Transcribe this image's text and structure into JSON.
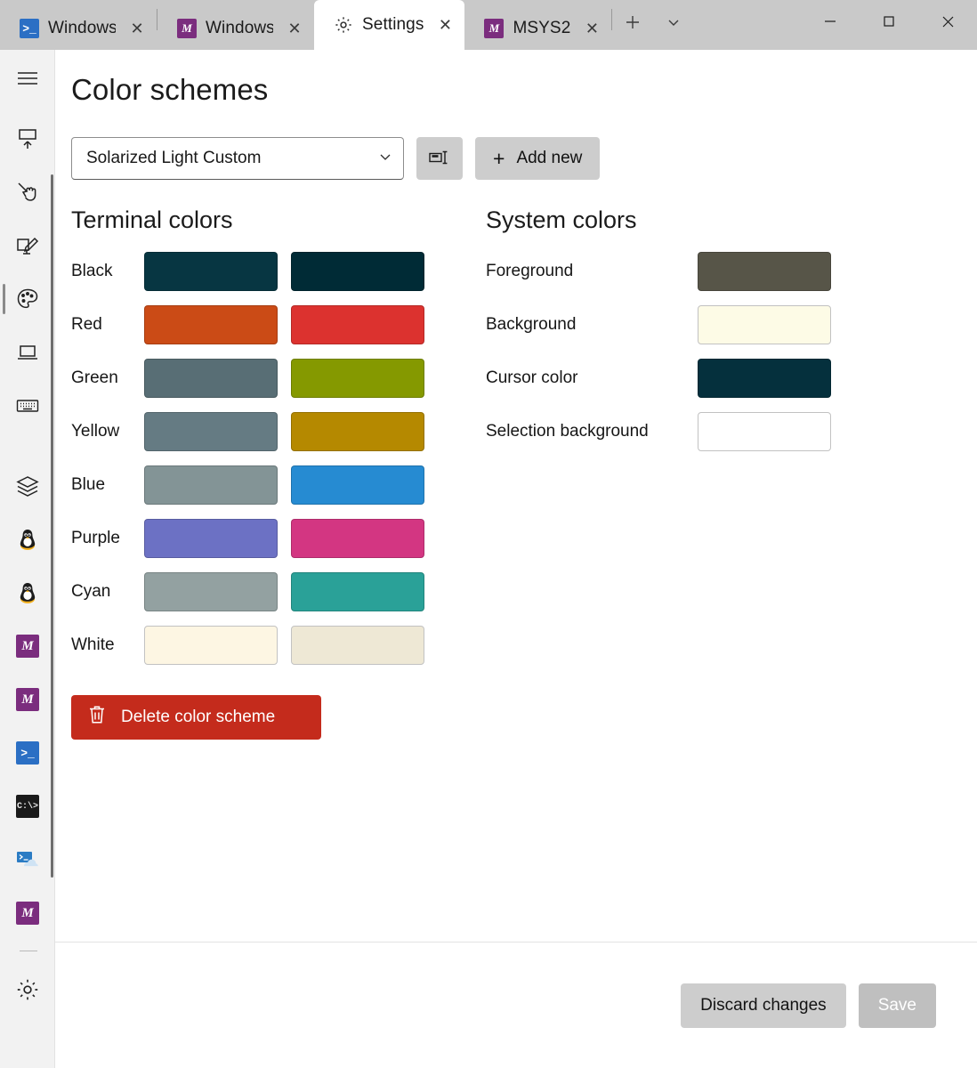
{
  "window": {
    "tabs": [
      {
        "icon": "powershell-icon",
        "label": "Windows PowerShell",
        "active": false
      },
      {
        "icon": "msys2-icon",
        "label": "Windows",
        "active": false
      },
      {
        "icon": "settings-gear-icon",
        "label": "Settings",
        "active": true
      },
      {
        "icon": "msys2-icon",
        "label": "MSYS2",
        "active": false
      }
    ],
    "close_label": "✕",
    "new_tab_label": "+",
    "dropdown_label": "⌄",
    "minimize_label": "─",
    "maximize_label": "□",
    "close_window_label": "✕"
  },
  "rail": {
    "items": [
      {
        "name": "hamburger-menu",
        "kind": "glyph"
      },
      {
        "name": "startup",
        "kind": "glyph"
      },
      {
        "name": "interaction",
        "kind": "glyph"
      },
      {
        "name": "appearance",
        "kind": "glyph"
      },
      {
        "name": "color-schemes",
        "kind": "glyph",
        "selected": true
      },
      {
        "name": "rendering",
        "kind": "glyph"
      },
      {
        "name": "actions",
        "kind": "glyph"
      },
      {
        "name": "profiles",
        "kind": "glyph"
      },
      {
        "name": "profile-linux-1",
        "kind": "tux"
      },
      {
        "name": "profile-linux-2",
        "kind": "tux"
      },
      {
        "name": "profile-msys2-1",
        "kind": "msys"
      },
      {
        "name": "profile-msys2-2",
        "kind": "msys"
      },
      {
        "name": "profile-powershell",
        "kind": "pwsh"
      },
      {
        "name": "profile-command-prompt",
        "kind": "cmd"
      },
      {
        "name": "profile-azure-cloud-shell",
        "kind": "azure"
      },
      {
        "name": "profile-msys2-3",
        "kind": "msys"
      },
      {
        "name": "open-json-settings",
        "kind": "gear"
      }
    ]
  },
  "page": {
    "title": "Color schemes"
  },
  "toolbar": {
    "scheme_name": "Solarized Light Custom",
    "chevron": "⌄",
    "rename_icon": "rename-icon",
    "add_new_label": "Add new",
    "add_new_plus": "+"
  },
  "terminal_colors": {
    "title": "Terminal colors",
    "rows": [
      {
        "label": "Black",
        "normal": "#073642",
        "bright": "#002b36"
      },
      {
        "label": "Red",
        "normal": "#cb4b16",
        "bright": "#dc322f"
      },
      {
        "label": "Green",
        "normal": "#586e75",
        "bright": "#859900"
      },
      {
        "label": "Yellow",
        "normal": "#657b83",
        "bright": "#b58900"
      },
      {
        "label": "Blue",
        "normal": "#839496",
        "bright": "#268bd2"
      },
      {
        "label": "Purple",
        "normal": "#6c71c4",
        "bright": "#d33682"
      },
      {
        "label": "Cyan",
        "normal": "#93a1a1",
        "bright": "#2aa198"
      },
      {
        "label": "White",
        "normal": "#fdf6e3",
        "bright": "#eee8d5"
      }
    ]
  },
  "system_colors": {
    "title": "System colors",
    "rows": [
      {
        "label": "Foreground",
        "color": "#575548"
      },
      {
        "label": "Background",
        "color": "#fdfbe6"
      },
      {
        "label": "Cursor color",
        "color": "#05303d"
      },
      {
        "label": "Selection background",
        "color": "#ffffff"
      }
    ]
  },
  "delete_button": {
    "label": "Delete color scheme",
    "icon": "trash-icon",
    "color": "#c42b1c"
  },
  "footer": {
    "discard_label": "Discard changes",
    "save_label": "Save"
  }
}
